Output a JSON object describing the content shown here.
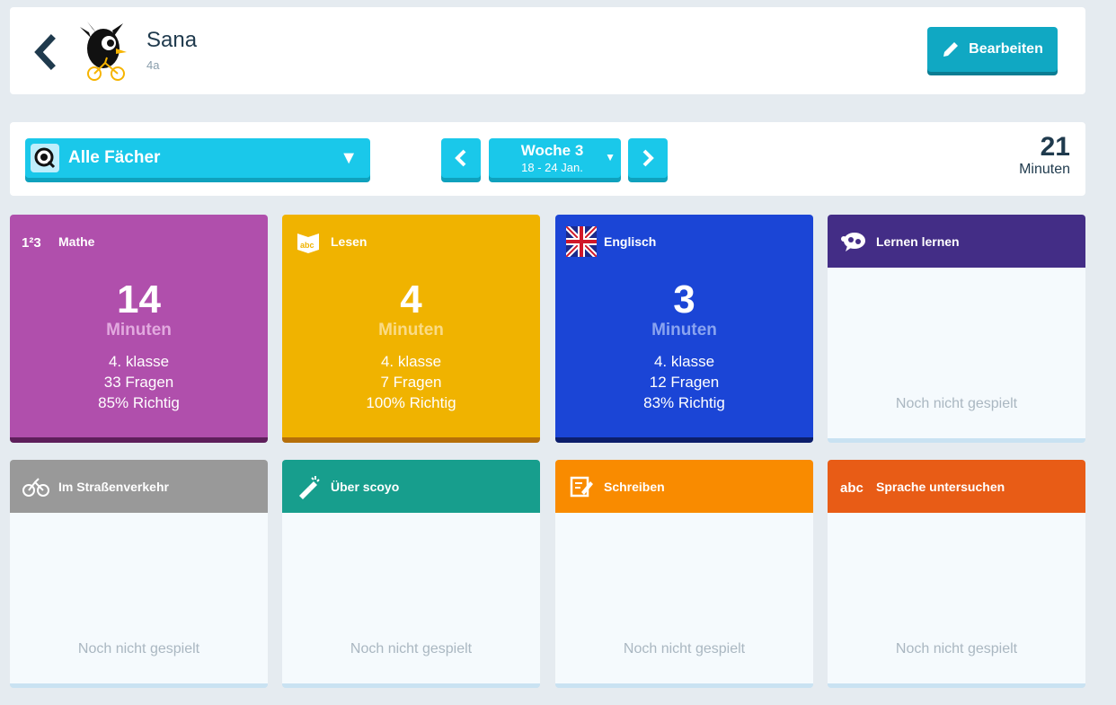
{
  "student": {
    "name": "Sana",
    "class": "4a"
  },
  "header": {
    "edit_label": "Bearbeiten"
  },
  "filters": {
    "subject_label": "Alle Fächer",
    "week_title": "Woche 3",
    "week_range": "18 - 24 Jan.",
    "total_minutes": "21",
    "total_unit": "Minuten"
  },
  "colors": {
    "accent": "#1ac8ea",
    "mathe": "#b04fac",
    "lesen": "#f0b300",
    "englisch": "#1b45d6",
    "lernen": "#432d86",
    "verkehr": "#999999",
    "scoyo": "#179e8d",
    "schreiben": "#f98b00",
    "sprache": "#e85c16"
  },
  "cards": [
    {
      "title": "Mathe",
      "icon": "numbers-icon",
      "minutes": "14",
      "unit": "Minuten",
      "grade": "4. klasse",
      "questions": "33 Fragen",
      "correct": "85% Richtig"
    },
    {
      "title": "Lesen",
      "icon": "abc-book-icon",
      "minutes": "4",
      "unit": "Minuten",
      "grade": "4. klasse",
      "questions": "7 Fragen",
      "correct": "100% Richtig"
    },
    {
      "title": "Englisch",
      "icon": "uk-flag-icon",
      "minutes": "3",
      "unit": "Minuten",
      "grade": "4. klasse",
      "questions": "12 Fragen",
      "correct": "83% Richtig"
    },
    {
      "title": "Lernen lernen",
      "icon": "brain-gears-icon",
      "empty": "Noch nicht gespielt"
    },
    {
      "title": "Im Straßenverkehr",
      "icon": "bicycle-icon",
      "empty": "Noch nicht gespielt"
    },
    {
      "title": "Über scoyo",
      "icon": "flashlight-icon",
      "empty": "Noch nicht gespielt"
    },
    {
      "title": "Schreiben",
      "icon": "writing-icon",
      "empty": "Noch nicht gespielt"
    },
    {
      "title": "Sprache untersuchen",
      "icon": "abc-icon",
      "empty": "Noch nicht gespielt"
    }
  ]
}
